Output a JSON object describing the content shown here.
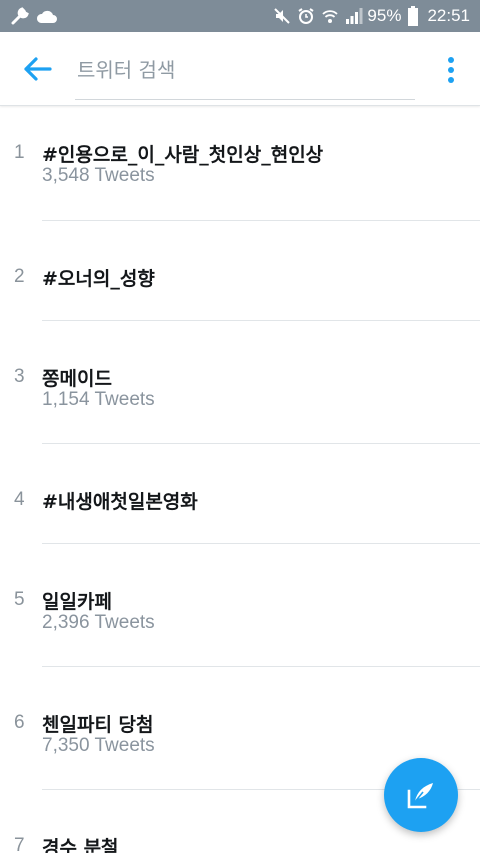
{
  "status_bar": {
    "battery_percent": "95%",
    "time": "22:51",
    "left_icons": [
      "wrench-icon",
      "cloud-icon"
    ],
    "right_icons": [
      "mute-icon",
      "alarm-icon",
      "wifi-icon",
      "signal-icon",
      "battery-icon"
    ]
  },
  "app_bar": {
    "search_placeholder": "트위터 검색",
    "back_icon": "arrow-left-icon",
    "menu_icon": "overflow-menu-icon",
    "accent_color": "#1da1f2"
  },
  "trends": [
    {
      "rank": "1",
      "name": "#인용으로_이_사람_첫인상_현인상",
      "count": "3,548 Tweets"
    },
    {
      "rank": "2",
      "name": "#오너의_성향",
      "count": ""
    },
    {
      "rank": "3",
      "name": "쫑메이드",
      "count": "1,154 Tweets"
    },
    {
      "rank": "4",
      "name": "#내생애첫일본영화",
      "count": ""
    },
    {
      "rank": "5",
      "name": "일일카페",
      "count": "2,396 Tweets"
    },
    {
      "rank": "6",
      "name": "첸일파티 당첨",
      "count": "7,350 Tweets"
    },
    {
      "rank": "7",
      "name": "경수 분철",
      "count": ""
    }
  ],
  "fab": {
    "icon": "compose-tweet-icon",
    "color": "#1da1f2"
  }
}
